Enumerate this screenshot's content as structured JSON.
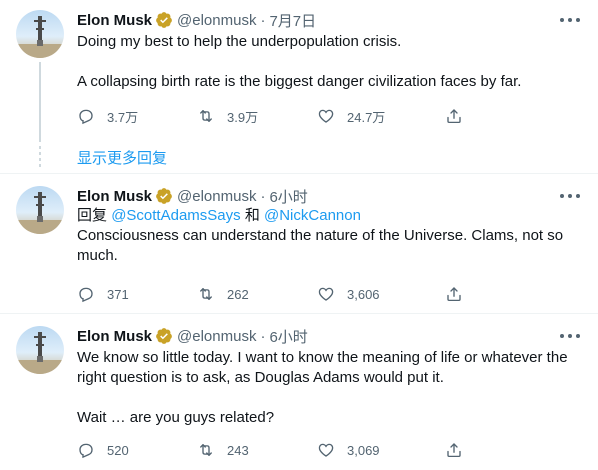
{
  "colors": {
    "accent": "#1d9bf0",
    "muted": "#536471",
    "text": "#0f1419",
    "verified_gold": "#c9a227"
  },
  "tweets": [
    {
      "author_name": "Elon Musk",
      "handle": "@elonmusk",
      "separator": "·",
      "time": "7月7日",
      "lines": [
        "Doing my best to help the underpopulation crisis.",
        "A collapsing birth rate is the biggest danger civilization faces by far."
      ],
      "replies": "3.7万",
      "retweets": "3.9万",
      "likes": "24.7万"
    },
    {
      "author_name": "Elon Musk",
      "handle": "@elonmusk",
      "separator": "·",
      "time": "6小时",
      "replying_prefix": "回复",
      "mention_1": "@ScottAdamsSays",
      "replying_and": "和",
      "mention_2": "@NickCannon",
      "lines": [
        "Consciousness can understand the nature of the Universe. Clams, not so much."
      ],
      "replies": "371",
      "retweets": "262",
      "likes": "3,606"
    },
    {
      "author_name": "Elon Musk",
      "handle": "@elonmusk",
      "separator": "·",
      "time": "6小时",
      "lines": [
        "We know so little today. I want to know the meaning of life or whatever the right question is to ask, as Douglas Adams would put it.",
        "Wait … are you guys related?"
      ],
      "replies": "520",
      "retweets": "243",
      "likes": "3,069"
    }
  ],
  "show_more_replies": "显示更多回复",
  "icons": [
    "avatar",
    "verified-badge-icon",
    "more-options-icon",
    "reply-icon",
    "retweet-icon",
    "like-icon",
    "share-icon"
  ]
}
